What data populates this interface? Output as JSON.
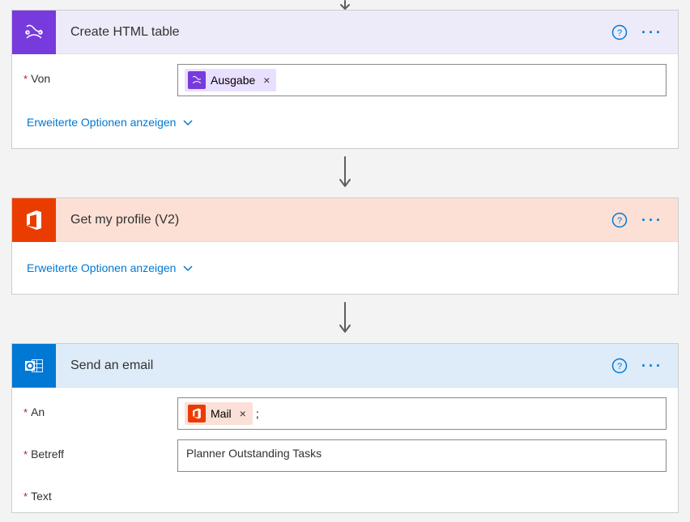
{
  "arrow_alt": "flow-arrow",
  "cards": {
    "html_table": {
      "title": "Create HTML table",
      "field_von_label": "Von",
      "token_ausgabe": "Ausgabe",
      "advanced": "Erweiterte Optionen anzeigen"
    },
    "profile": {
      "title": "Get my profile (V2)",
      "advanced": "Erweiterte Optionen anzeigen"
    },
    "email": {
      "title": "Send an email",
      "field_an_label": "An",
      "token_mail": "Mail",
      "an_extra_text": ";",
      "field_betreff_label": "Betreff",
      "betreff_value": "Planner Outstanding Tasks",
      "field_text_label": "Text"
    }
  }
}
